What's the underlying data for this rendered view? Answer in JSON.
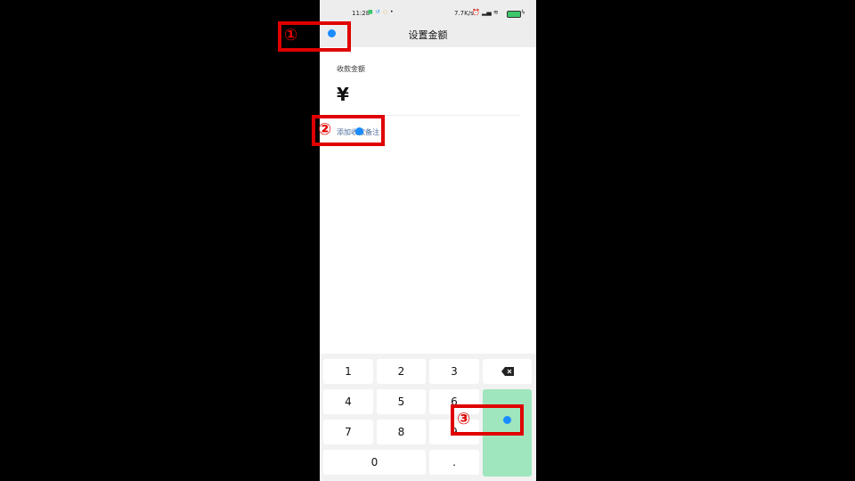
{
  "status_bar": {
    "time": "11:28",
    "net_speed": "7.7K/s",
    "signal": "ℵᵗᵃᴵᴸᵗᵃᴸ •",
    "right_icons": "⏰ ▁▂▃ ▼"
  },
  "nav": {
    "title": "设置金额"
  },
  "form": {
    "amount_label": "收款金额",
    "currency_symbol": "¥",
    "remark_link": "添加收款备注"
  },
  "keypad": {
    "keys": [
      "1",
      "2",
      "3",
      "4",
      "5",
      "6",
      "7",
      "8",
      "9",
      "0",
      "."
    ]
  },
  "annotations": {
    "one": "①",
    "two": "②",
    "three": "③"
  },
  "colors": {
    "confirm": "#9fe6be",
    "annotation": "#e00000",
    "tap_dot": "#1a8cff"
  }
}
